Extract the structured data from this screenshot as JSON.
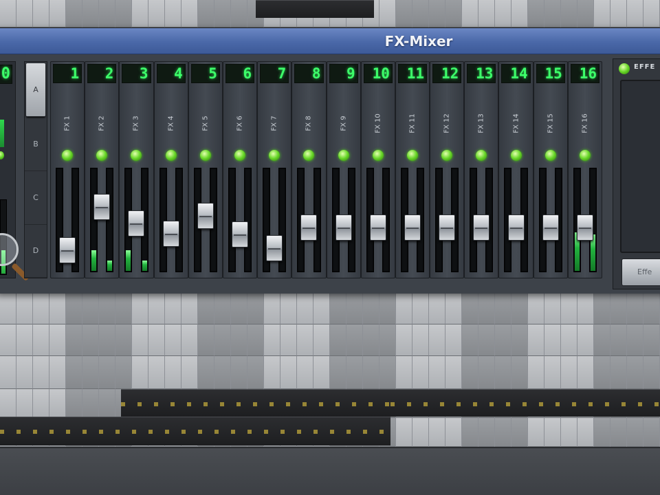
{
  "window": {
    "title": "FX-Mixer"
  },
  "master": {
    "number": "0"
  },
  "banks": [
    {
      "label": "A",
      "active": true
    },
    {
      "label": "B",
      "active": false
    },
    {
      "label": "C",
      "active": false
    },
    {
      "label": "D",
      "active": false
    }
  ],
  "channels": [
    {
      "number": "1",
      "name": "FX 1",
      "fader": 0.12,
      "meter_l": 0.0,
      "meter_r": 0.0
    },
    {
      "number": "2",
      "name": "FX 2",
      "fader": 0.68,
      "meter_l": 0.2,
      "meter_r": 0.1
    },
    {
      "number": "3",
      "name": "FX 3",
      "fader": 0.46,
      "meter_l": 0.2,
      "meter_r": 0.1
    },
    {
      "number": "4",
      "name": "FX 4",
      "fader": 0.33,
      "meter_l": 0.0,
      "meter_r": 0.0
    },
    {
      "number": "5",
      "name": "FX 5",
      "fader": 0.56,
      "meter_l": 0.0,
      "meter_r": 0.0
    },
    {
      "number": "6",
      "name": "FX 6",
      "fader": 0.32,
      "meter_l": 0.0,
      "meter_r": 0.0
    },
    {
      "number": "7",
      "name": "FX 7",
      "fader": 0.14,
      "meter_l": 0.0,
      "meter_r": 0.0
    },
    {
      "number": "8",
      "name": "FX 8",
      "fader": 0.41,
      "meter_l": 0.0,
      "meter_r": 0.0
    },
    {
      "number": "9",
      "name": "FX 9",
      "fader": 0.41,
      "meter_l": 0.0,
      "meter_r": 0.0
    },
    {
      "number": "10",
      "name": "FX 10",
      "fader": 0.41,
      "meter_l": 0.0,
      "meter_r": 0.0
    },
    {
      "number": "11",
      "name": "FX 11",
      "fader": 0.41,
      "meter_l": 0.0,
      "meter_r": 0.0
    },
    {
      "number": "12",
      "name": "FX 12",
      "fader": 0.41,
      "meter_l": 0.0,
      "meter_r": 0.0
    },
    {
      "number": "13",
      "name": "FX 13",
      "fader": 0.41,
      "meter_l": 0.0,
      "meter_r": 0.0
    },
    {
      "number": "14",
      "name": "FX 14",
      "fader": 0.41,
      "meter_l": 0.0,
      "meter_r": 0.0
    },
    {
      "number": "15",
      "name": "FX 15",
      "fader": 0.41,
      "meter_l": 0.0,
      "meter_r": 0.0
    },
    {
      "number": "16",
      "name": "FX 16",
      "fader": 0.41,
      "meter_l": 0.38,
      "meter_r": 0.36
    }
  ],
  "effects_panel": {
    "title": "EFFE",
    "button_label": "Effe"
  },
  "colors": {
    "lcd_digit": "#3dff6a",
    "led_on": "#67d627",
    "title_bar": "#4a68a8"
  },
  "icons": {
    "magnifier": "magnifier-icon"
  }
}
